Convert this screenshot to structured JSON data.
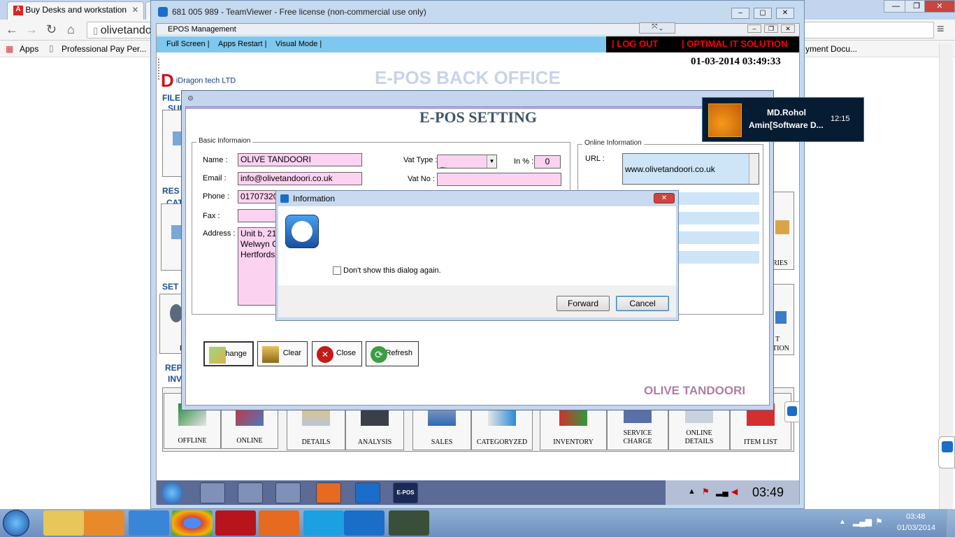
{
  "browser": {
    "tabs": [
      {
        "label": "Buy Desks and workstation"
      },
      {
        "label": ""
      }
    ],
    "url": "olivetando",
    "bookmarks": [
      "Apps",
      "Professional Pay Per..."
    ],
    "bookmark_right": "yment Docu..."
  },
  "teamviewer": {
    "title": "681 005 989 - TeamViewer - Free license (non-commercial use only)"
  },
  "epos": {
    "window_title": "EPOS Management",
    "menu": [
      "Full Screen |",
      "Apps Restart |",
      "Visual Mode |"
    ],
    "logout": "|   LOG OUT",
    "company": "| OPTIMAL IT SOLUTION",
    "datetime": "01-03-2014 03:49:33",
    "brand": "iDragon tech LTD",
    "header": "E-POS BACK OFFICE",
    "sections": {
      "file": "FILE",
      "file_sub": "SUI",
      "res": "RES",
      "res_sub": "CAT",
      "set": "SET",
      "rep": "REP",
      "rep_sub": "INV"
    },
    "right_labels": {
      "ries": "RIES",
      "ution_a": "T",
      "ution_b": "TION"
    },
    "partial_labels": {
      "a": "A",
      "b": "E"
    },
    "modules": [
      {
        "label": "OFFLINE"
      },
      {
        "label": "ONLINE"
      },
      {
        "label": "DETAILS"
      },
      {
        "label": "ANALYSIS"
      },
      {
        "label": "SALES"
      },
      {
        "label": "CATEGORYZED"
      },
      {
        "label": "INVENTORY"
      },
      {
        "label": "SERVICE\nCHARGE"
      },
      {
        "label": "ONLINE\nDETAILS"
      },
      {
        "label": "ITEM LIST"
      }
    ],
    "clock": "03:49",
    "taskbar_epos_label": "E-POS"
  },
  "settings": {
    "title": "E-POS SETTING",
    "basic_group": "Basic Informaion",
    "online_group": "Online Information",
    "labels": {
      "name": "Name :",
      "email": "Email :",
      "phone": "Phone :",
      "fax": "Fax :",
      "address": "Address :",
      "vat_type": "Vat Type :",
      "in_percent": "In % :",
      "vat_no": "Vat No :",
      "url": "URL :"
    },
    "values": {
      "name": "OLIVE TANDOORI",
      "email": "info@olivetandoori.co.uk",
      "phone": "01707320",
      "fax": "",
      "address": "Unit b, 21\nWelwyn G\nHertfordsh",
      "vat_type": "Flat",
      "in_percent": "0",
      "vat_no": "",
      "url": "www.olivetandoori.co.uk"
    },
    "buttons": {
      "change": "Change",
      "clear": "Clear",
      "close": "Close",
      "refresh": "Refresh"
    },
    "footer_brand": "OLIVE TANDOORI"
  },
  "dialog": {
    "title": "Information",
    "checkbox_label": "Don't show this dialog again.",
    "forward": "Forward",
    "cancel": "Cancel"
  },
  "notification": {
    "name": "MD.Rohol",
    "subtitle": "Amin[Software D...",
    "time": "12:15"
  },
  "system": {
    "time": "03:48",
    "date": "01/03/2014"
  },
  "colors": {
    "epos_menu": "#7ec8ef",
    "field_pink": "#fcd2f1",
    "brand_red": "#ff0000",
    "section_blue": "#1d4f8f"
  }
}
